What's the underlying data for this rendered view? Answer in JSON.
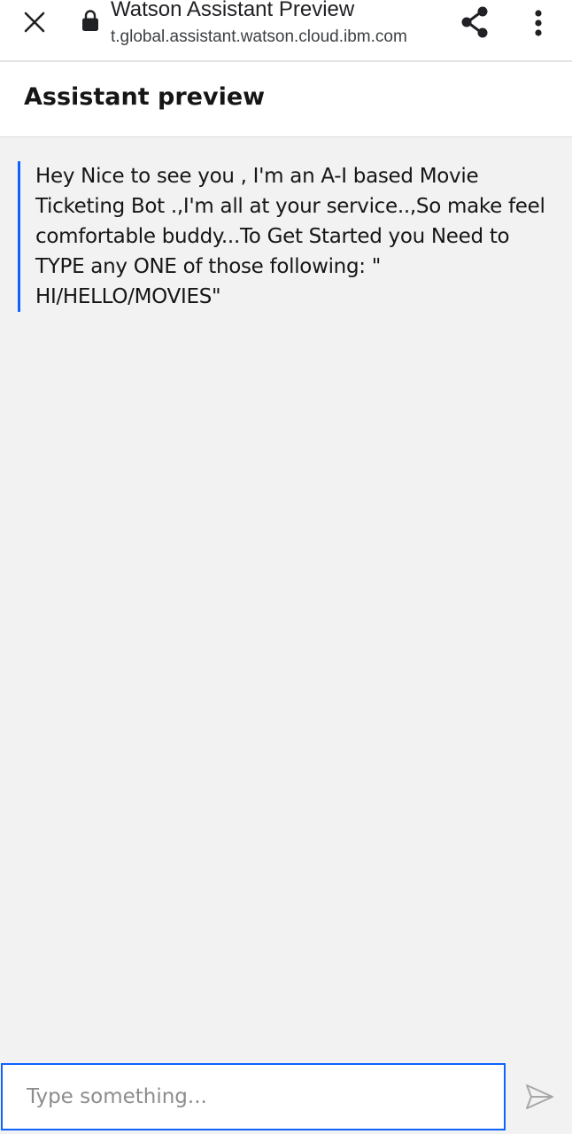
{
  "browser": {
    "title": "Watson Assistant Preview",
    "url": "t.global.assistant.watson.cloud.ibm.com",
    "icons": {
      "close": "close-icon",
      "lock": "lock-icon",
      "share": "share-icon",
      "menu": "more-vert-icon"
    }
  },
  "header": {
    "title": "Assistant preview"
  },
  "chat": {
    "messages": [
      {
        "sender": "assistant",
        "text": "Hey Nice to see you , I'm an A-I based Movie Ticketing Bot .,I'm all at your service..,So make feel comfortable buddy...To Get Started you Need to TYPE any ONE of those following: \" HI/HELLO/MOVIES\""
      }
    ]
  },
  "composer": {
    "placeholder": "Type something...",
    "value": "",
    "send_icon": "send-icon"
  },
  "colors": {
    "accent": "#0f62fe",
    "background": "#f2f2f2",
    "header_background": "#ffffff",
    "text": "#161616"
  }
}
